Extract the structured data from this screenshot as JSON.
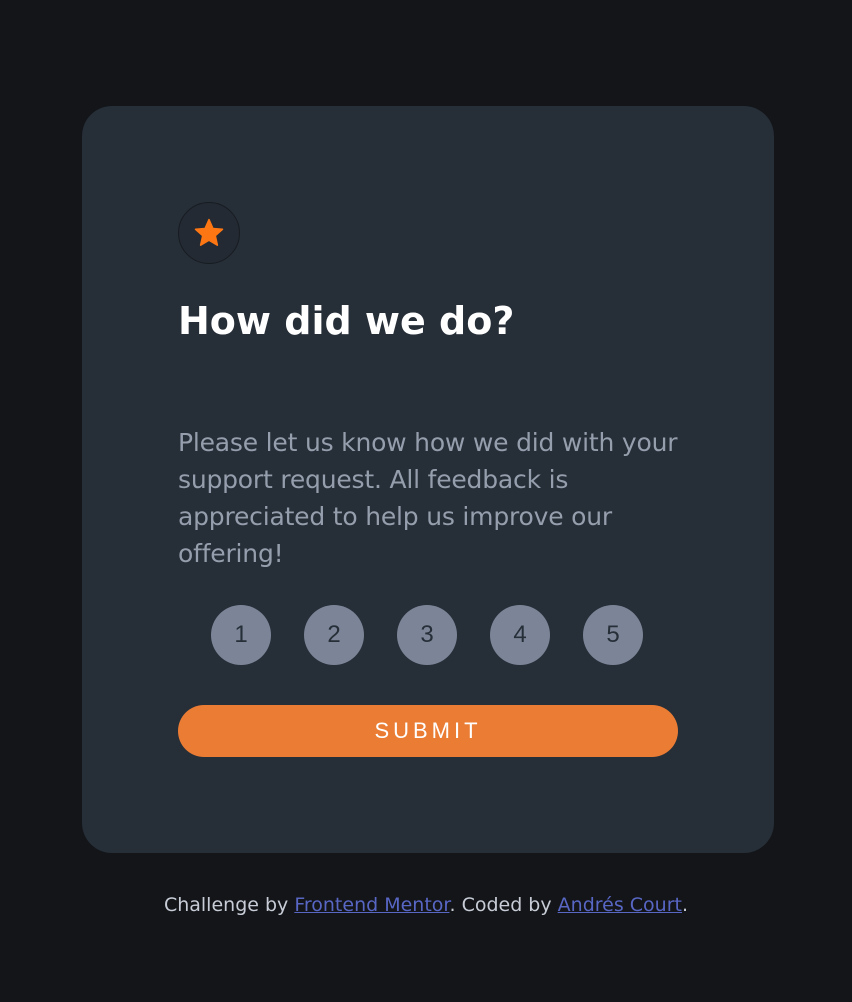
{
  "card": {
    "title": "How did we do?",
    "description": "Please let us know how we did with your support request. All feedback is appreciated to help us improve our offering!",
    "star_icon": "star-icon",
    "ratings": [
      "1",
      "2",
      "3",
      "4",
      "5"
    ],
    "submit_label": "SUBMIT"
  },
  "attribution": {
    "prefix": "Challenge by ",
    "link1": "Frontend Mentor",
    "middle": ". Coded by ",
    "link2": "Andrés Court",
    "suffix": "."
  },
  "colors": {
    "background": "#131518",
    "card": "#262e38",
    "accent": "#ea7c34",
    "rating_bg": "#7b8597",
    "text_muted": "#959eac",
    "link": "#5866c4"
  }
}
